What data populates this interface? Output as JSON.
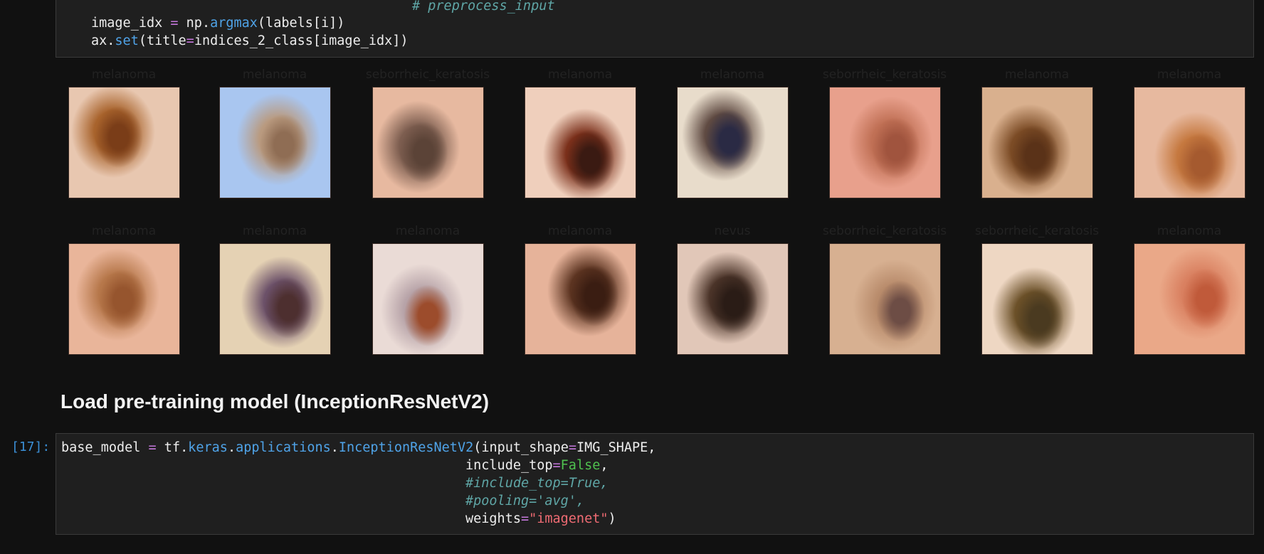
{
  "cell_top": {
    "comment": "# preprocess_input",
    "line1": {
      "var": "image_idx ",
      "eq": "=",
      "np": " np.",
      "fn": "argmax",
      "rest": "(labels[i])"
    },
    "line2": {
      "a": "ax.",
      "fn": "set",
      "b": "(title",
      "eq": "=",
      "c": "indices_2_class[image_idx])"
    }
  },
  "thumbnails": [
    {
      "label": "melanoma",
      "palette": [
        "#e8c7b0",
        "#a8632c",
        "#7a3d18"
      ]
    },
    {
      "label": "melanoma",
      "palette": [
        "#a9c6f0",
        "#b99a7f",
        "#8f6d54"
      ]
    },
    {
      "label": "seborrheic_keratosis",
      "palette": [
        "#e7b9a0",
        "#7c5d4f",
        "#5b4337"
      ]
    },
    {
      "label": "melanoma",
      "palette": [
        "#efcfbc",
        "#7a2f1a",
        "#3a1a12"
      ]
    },
    {
      "label": "melanoma",
      "palette": [
        "#e8dccb",
        "#5f4a42",
        "#2a2a44"
      ]
    },
    {
      "label": "seborrheic_keratosis",
      "palette": [
        "#e8a08c",
        "#c07055",
        "#a0543e"
      ]
    },
    {
      "label": "melanoma",
      "palette": [
        "#d9b08e",
        "#7b4b25",
        "#5a3218"
      ]
    },
    {
      "label": "melanoma",
      "palette": [
        "#e7b99f",
        "#c5783f",
        "#a55a2f"
      ]
    },
    {
      "label": "melanoma",
      "palette": [
        "#e9b59a",
        "#b6774a",
        "#96552e"
      ]
    },
    {
      "label": "melanoma",
      "palette": [
        "#e5d2b4",
        "#6b5068",
        "#4d2f2f"
      ]
    },
    {
      "label": "melanoma",
      "palette": [
        "#eadbd6",
        "#b7a3a8",
        "#9c4c2c"
      ]
    },
    {
      "label": "melanoma",
      "palette": [
        "#e6b39a",
        "#5b3320",
        "#3a1d12"
      ]
    },
    {
      "label": "nevus",
      "palette": [
        "#e1c7b8",
        "#4a3328",
        "#2a1c16"
      ]
    },
    {
      "label": "seborrheic_keratosis",
      "palette": [
        "#d7b091",
        "#b88b6b",
        "#6d4d45"
      ]
    },
    {
      "label": "seborrheic_keratosis",
      "palette": [
        "#eed7c3",
        "#6b5028",
        "#4a3a20"
      ]
    },
    {
      "label": "melanoma",
      "palette": [
        "#eaa888",
        "#d98060",
        "#c05a3a"
      ]
    }
  ],
  "heading": "Load pre-training model (InceptionResNetV2)",
  "cell_17": {
    "prompt": "[17]:",
    "l1": {
      "a": "base_model ",
      "eq": "=",
      "b": " tf.",
      "keras": "keras",
      "dot1": ".",
      "apps": "applications",
      "dot2": ".",
      "cls": "InceptionResNetV2",
      "c": "(input_shape",
      "eq2": "=",
      "d": "IMG_SHAPE,"
    },
    "l2": {
      "a": "include_top",
      "eq": "=",
      "b": "False",
      "c": ","
    },
    "l3": "#include_top=True,",
    "l4": "#pooling='avg',",
    "l5": {
      "a": "weights",
      "eq": "=",
      "b": "\"imagenet\"",
      "c": ")"
    }
  }
}
